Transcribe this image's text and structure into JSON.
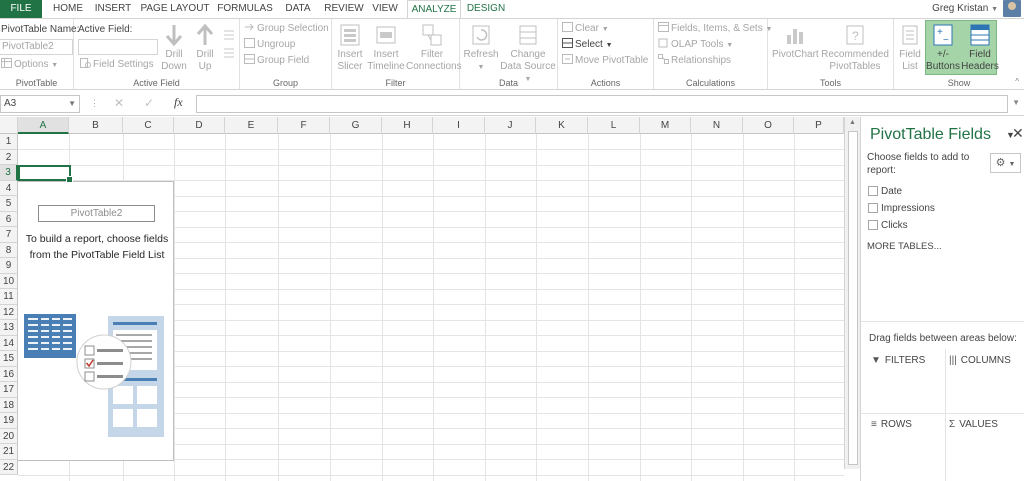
{
  "tabs": [
    {
      "label": "FILE"
    },
    {
      "label": "HOME"
    },
    {
      "label": "INSERT"
    },
    {
      "label": "PAGE LAYOUT"
    },
    {
      "label": "FORMULAS"
    },
    {
      "label": "DATA"
    },
    {
      "label": "REVIEW"
    },
    {
      "label": "VIEW"
    },
    {
      "label": "ANALYZE"
    },
    {
      "label": "DESIGN"
    }
  ],
  "user": {
    "name": "Greg Kristan"
  },
  "ribbon": {
    "pivottable": {
      "name_label": "PivotTable Name:",
      "name_value": "PivotTable2",
      "options": "Options",
      "group": "PivotTable"
    },
    "active_field": {
      "label": "Active Field:",
      "field_settings": "Field Settings",
      "drill_down": "Drill Down",
      "drill_up": "Drill Up",
      "group": "Active Field"
    },
    "group": {
      "group_selection": "Group Selection",
      "ungroup": "Ungroup",
      "group_field": "Group Field",
      "group": "Group"
    },
    "filter": {
      "insert_slicer": "Insert Slicer",
      "insert_timeline": "Insert Timeline",
      "filter_connections": "Filter Connections",
      "group": "Filter"
    },
    "data": {
      "refresh": "Refresh",
      "change_source": "Change Data Source",
      "group": "Data"
    },
    "actions": {
      "clear": "Clear",
      "select": "Select",
      "move": "Move PivotTable",
      "group": "Actions"
    },
    "calculations": {
      "fields_items": "Fields, Items, & Sets",
      "olap": "OLAP Tools",
      "relationships": "Relationships",
      "group": "Calculations"
    },
    "tools": {
      "pivotchart": "PivotChart",
      "recommended": "Recommended PivotTables",
      "group": "Tools"
    },
    "show": {
      "field_list": "Field List",
      "buttons": "+/- Buttons",
      "headers": "Field Headers",
      "group": "Show"
    }
  },
  "formula_bar": {
    "name_box": "A3",
    "fx": "fx",
    "formula": ""
  },
  "grid": {
    "columns": [
      "A",
      "B",
      "C",
      "D",
      "E",
      "F",
      "G",
      "H",
      "I",
      "J",
      "K",
      "L",
      "M",
      "N",
      "O",
      "P"
    ],
    "rows": [
      "1",
      "2",
      "3",
      "4",
      "5",
      "6",
      "7",
      "8",
      "9",
      "10",
      "11",
      "12",
      "13",
      "14",
      "15",
      "16",
      "17",
      "18",
      "19",
      "20",
      "21",
      "22"
    ],
    "selected_cell": "A3"
  },
  "pivot_placeholder": {
    "name": "PivotTable2",
    "message": "To build a report, choose fields from the PivotTable Field List"
  },
  "field_pane": {
    "title": "PivotTable Fields",
    "choose": "Choose fields to add to report:",
    "fields": [
      {
        "label": "Date",
        "checked": false
      },
      {
        "label": "Impressions",
        "checked": false
      },
      {
        "label": "Clicks",
        "checked": false
      }
    ],
    "more_tables": "MORE TABLES...",
    "drag_text": "Drag fields between areas below:",
    "areas": {
      "filters": "FILTERS",
      "columns": "COLUMNS",
      "rows": "ROWS",
      "values": "VALUES"
    }
  },
  "colors": {
    "accent": "#217346",
    "highlight": "#a4d4a8"
  }
}
